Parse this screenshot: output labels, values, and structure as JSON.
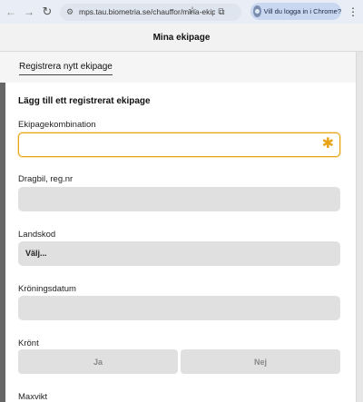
{
  "browser": {
    "url": "mps.tau.biometria.se/chauffor/mina-ekip...",
    "signin_label": "Vill du logga in i Chrome?"
  },
  "header": {
    "title": "Mina ekipage"
  },
  "register": {
    "link_label": "Registrera nytt ekipage"
  },
  "form": {
    "section_title": "Lägg till ett registrerat ekipage",
    "fields": [
      {
        "label": "Ekipagekombination",
        "value": "",
        "required_mark": "✱"
      },
      {
        "label": "Dragbil, reg.nr",
        "value": ""
      },
      {
        "label": "Landskod",
        "selected": "Välj..."
      },
      {
        "label": "Kröningsdatum",
        "value": ""
      }
    ],
    "kront": {
      "label": "Krönt",
      "yes": "Ja",
      "no": "Nej"
    },
    "maxvikt": {
      "label": "Maxvikt"
    }
  },
  "colors": {
    "accent": "#e8a317",
    "field_bg": "#e0e0e0",
    "header_bg": "#f2f2f2"
  }
}
